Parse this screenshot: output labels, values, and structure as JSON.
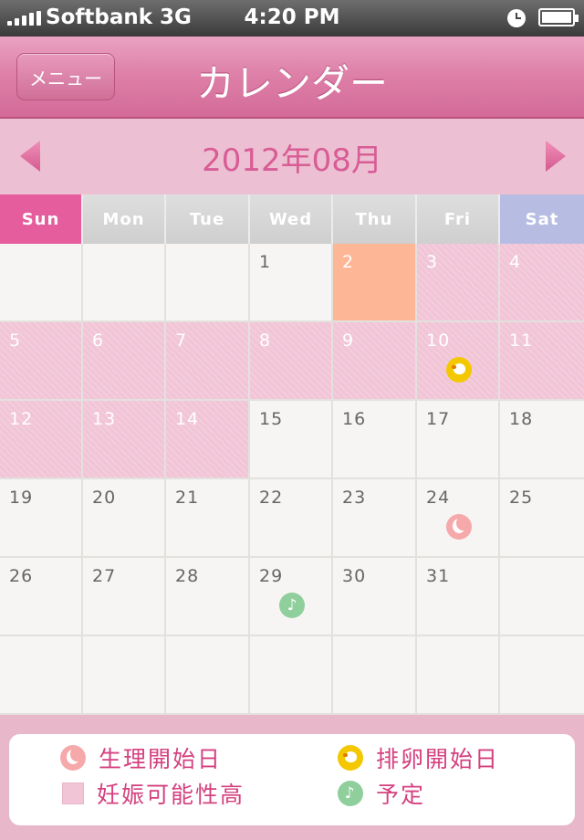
{
  "status_bar": {
    "carrier": "Softbank 3G",
    "time": "4:20 PM",
    "clock_icon": "clock-icon",
    "battery_icon": "battery-icon"
  },
  "nav": {
    "menu_label": "メニュー",
    "title": "カレンダー"
  },
  "month": {
    "label": "2012年08月",
    "prev_icon": "triangle-left-icon",
    "next_icon": "triangle-right-icon"
  },
  "weekdays": [
    "Sun",
    "Mon",
    "Tue",
    "Wed",
    "Thu",
    "Fri",
    "Sat"
  ],
  "calendar": {
    "first_weekday_index": 3,
    "days_in_month": 31,
    "rows": 6,
    "today": 2,
    "fertile_days": [
      3,
      4,
      5,
      6,
      7,
      8,
      9,
      10,
      11,
      12,
      13,
      14
    ],
    "markers": [
      {
        "day": 10,
        "type": "ovulation"
      },
      {
        "day": 24,
        "type": "period"
      },
      {
        "day": 29,
        "type": "schedule"
      }
    ]
  },
  "legend": {
    "period_start": "生理開始日",
    "ovulation_start": "排卵開始日",
    "high_fertility": "妊娠可能性高",
    "schedule": "予定"
  },
  "colors": {
    "nav": "#d46a98",
    "accent_text": "#d85c95",
    "fertile": "#f1c4d6",
    "today": "#feb796",
    "ovulation": "#f3c800",
    "period": "#f6a9ab",
    "schedule": "#8fcf9c",
    "sunday": "#e55d9c",
    "saturday": "#b7bde2"
  }
}
